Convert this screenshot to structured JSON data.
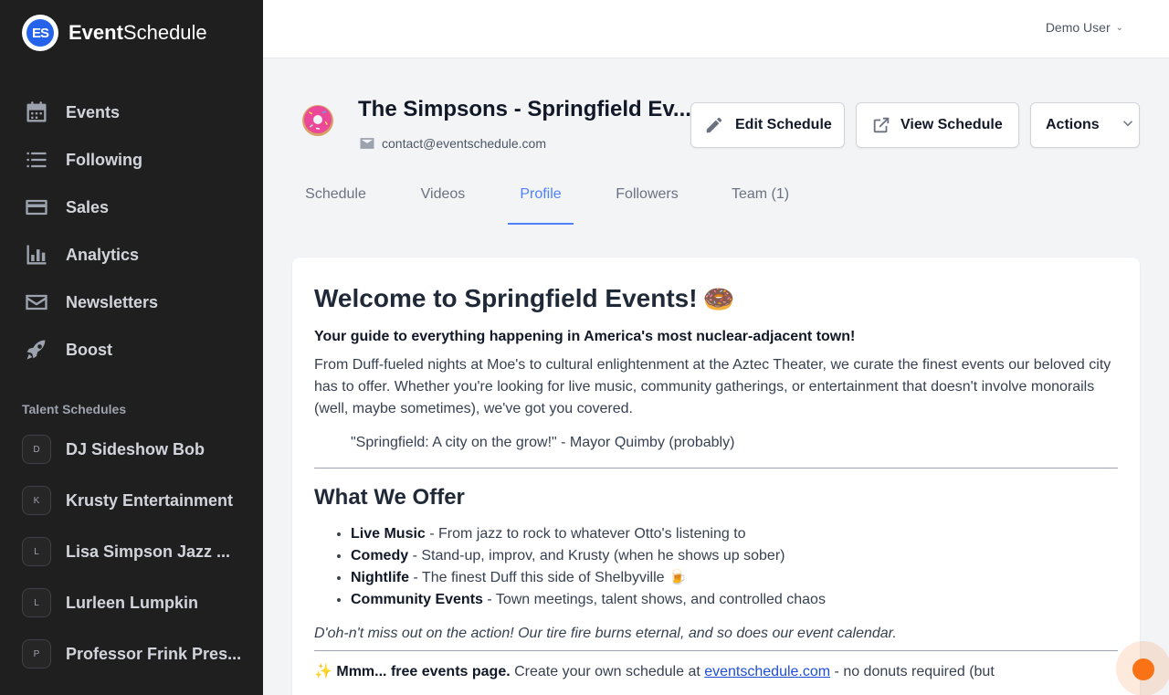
{
  "brand": {
    "logo_text": "ES",
    "name_bold": "Event",
    "name_rest": "Schedule"
  },
  "sidebar": {
    "nav": [
      {
        "label": "Events",
        "icon": "calendar-icon"
      },
      {
        "label": "Following",
        "icon": "list-icon"
      },
      {
        "label": "Sales",
        "icon": "credit-card-icon"
      },
      {
        "label": "Analytics",
        "icon": "bar-chart-icon"
      },
      {
        "label": "Newsletters",
        "icon": "envelope-icon"
      },
      {
        "label": "Boost",
        "icon": "rocket-icon"
      }
    ],
    "talent_title": "Talent Schedules",
    "talent": [
      {
        "initial": "D",
        "name": "DJ Sideshow Bob"
      },
      {
        "initial": "K",
        "name": "Krusty Entertainment"
      },
      {
        "initial": "L",
        "name": "Lisa Simpson Jazz ..."
      },
      {
        "initial": "L",
        "name": "Lurleen Lumpkin"
      },
      {
        "initial": "P",
        "name": "Professor Frink Pres..."
      }
    ]
  },
  "topbar": {
    "user": "Demo User"
  },
  "header": {
    "avatar_emoji": "🍩",
    "title": "The Simpsons - Springfield Ev...",
    "email": "contact@eventschedule.com",
    "edit_label": "Edit Schedule",
    "view_label": "View Schedule",
    "actions_label": "Actions"
  },
  "tabs": [
    "Schedule",
    "Videos",
    "Profile",
    "Followers",
    "Team (1)"
  ],
  "active_tab": "Profile",
  "content": {
    "h1": "Welcome to Springfield Events!",
    "h1_emoji": "🍩",
    "lead": "Your guide to everything happening in America's most nuclear-adjacent town!",
    "para": "From Duff-fueled nights at Moe's to cultural enlightenment at the Aztec Theater, we curate the finest events our beloved city has to offer. Whether you're looking for live music, community gatherings, or entertainment that doesn't involve monorails (well, maybe sometimes), we've got you covered.",
    "quote": "\"Springfield: A city on the grow!\" - Mayor Quimby (probably)",
    "h2": "What We Offer",
    "offers": [
      {
        "title": "Live Music",
        "text": " - From jazz to rock to whatever Otto's listening to"
      },
      {
        "title": "Comedy",
        "text": " - Stand-up, improv, and Krusty (when he shows up sober)"
      },
      {
        "title": "Nightlife",
        "text": " - The finest Duff this side of Shelbyville 🍺"
      },
      {
        "title": "Community Events",
        "text": " - Town meetings, talent shows, and controlled chaos"
      }
    ],
    "italic": "D'oh-n't miss out on the action! Our tire fire burns eternal, and so does our event calendar.",
    "footer_sparkle": "✨",
    "footer_bold": "Mmm... free events page.",
    "footer_text": " Create your own schedule at ",
    "footer_link": "eventschedule.com",
    "footer_tail": " - no donuts required (but"
  },
  "colors": {
    "accent": "#4e81fa",
    "sidebar_bg": "#1f1f1f",
    "fab": "#f97316"
  }
}
